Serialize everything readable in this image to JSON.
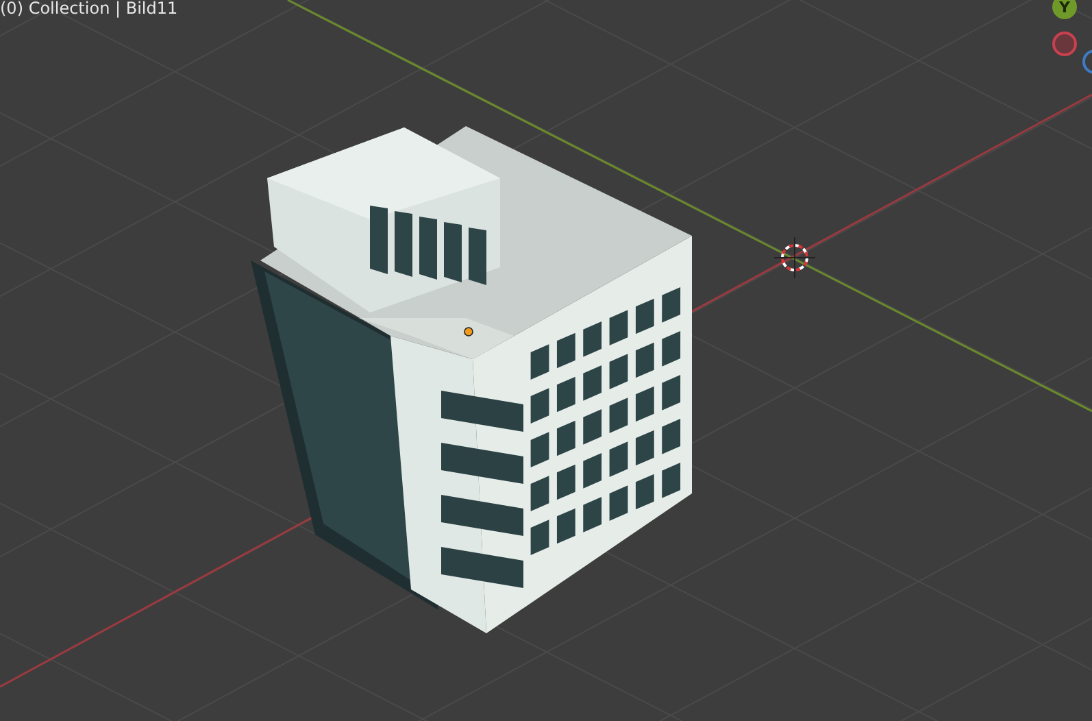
{
  "viewport": {
    "object_info": "(0) Collection | Bild11"
  },
  "gizmo": {
    "y_label": "Y"
  }
}
